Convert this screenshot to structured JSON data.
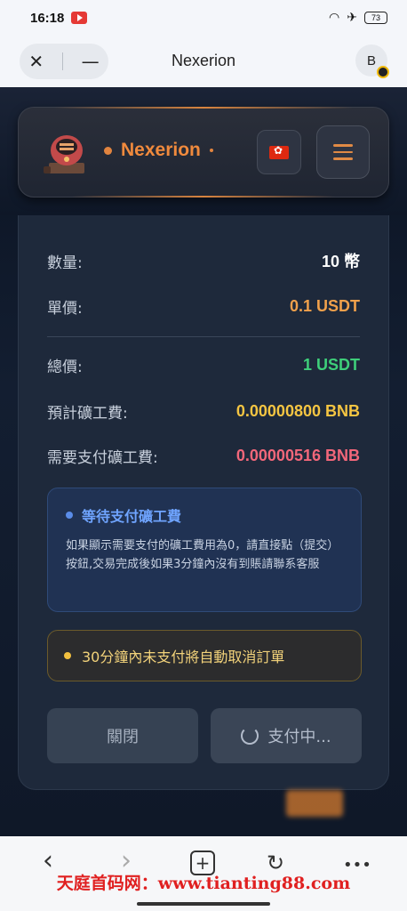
{
  "status_bar": {
    "time": "16:18",
    "battery": "73"
  },
  "browser": {
    "title": "Nexerion",
    "close_glyph": "✕",
    "minimize_glyph": "—",
    "extension_label": "B"
  },
  "header": {
    "brand": "Nexerion"
  },
  "order": {
    "rows": [
      {
        "label": "數量:",
        "value": "10 幣",
        "color": "#ffffff"
      },
      {
        "label": "單價:",
        "value": "0.1 USDT",
        "color": "#f0a04b"
      },
      {
        "label": "總價:",
        "value": "1 USDT",
        "color": "#3ecf7a"
      },
      {
        "label": "預計礦工費:",
        "value": "0.00000800 BNB",
        "color": "#f5c542"
      },
      {
        "label": "需要支付礦工費:",
        "value": "0.00000516 BNB",
        "color": "#f2677a"
      }
    ]
  },
  "info_box": {
    "title": "等待支付礦工費",
    "body": "如果顯示需要支付的礦工費用為0，請直接點（提交）按鈕,交易完成後如果3分鐘內沒有到賬請聯系客服"
  },
  "warning": {
    "text": "30分鐘內未支付將自動取消訂單"
  },
  "buttons": {
    "close": "關閉",
    "pay": "支付中..."
  },
  "bottom_nav": {
    "back": "‹",
    "forward": "›",
    "new_tab": "+",
    "reload": "↻",
    "more": "•••"
  },
  "watermark": "天庭首码网：www.tianting88.com"
}
